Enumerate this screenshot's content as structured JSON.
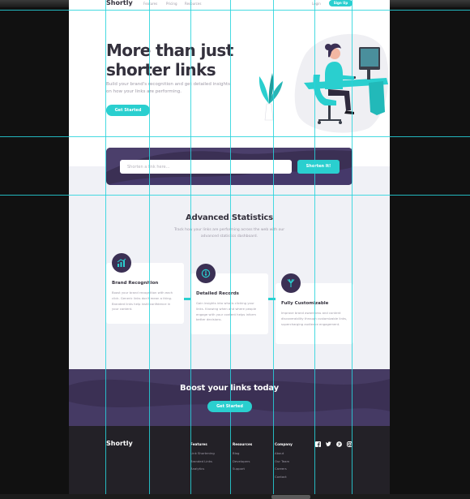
{
  "nav": {
    "logo": "Shortly",
    "links": [
      "Features",
      "Pricing",
      "Resources"
    ],
    "login": "Login",
    "signup": "Sign Up"
  },
  "hero": {
    "title": "More than just shorter links",
    "subtitle": "Build your brand's recognition and get detailed insights on how your links are performing.",
    "cta": "Get Started"
  },
  "shorten": {
    "placeholder": "Shorten a link here...",
    "button": "Shorten It!"
  },
  "statistics": {
    "title": "Advanced Statistics",
    "subtitle": "Track how your links are performing across the web with our advanced statistics dashboard.",
    "cards": [
      {
        "icon": "bar-chart-icon",
        "title": "Brand Recognition",
        "text": "Boost your brand recognition with each click. Generic links don't mean a thing. Branded links help instil confidence in your content."
      },
      {
        "icon": "gauge-icon",
        "title": "Detailed Records",
        "text": "Gain insights into who is clicking your links. Knowing when and where people engage with your content helps inform better decisions."
      },
      {
        "icon": "brush-icon",
        "title": "Fully Customizable",
        "text": "Improve brand awareness and content discoverability through customizable links, supercharging audience engagement."
      }
    ]
  },
  "boost": {
    "title": "Boost your links today",
    "cta": "Get Started"
  },
  "footer": {
    "logo": "Shortly",
    "columns": [
      {
        "title": "Features",
        "links": [
          "Link Shortening",
          "Branded Links",
          "Analytics"
        ]
      },
      {
        "title": "Resources",
        "links": [
          "Blog",
          "Developers",
          "Support"
        ]
      },
      {
        "title": "Company",
        "links": [
          "About",
          "Our Team",
          "Careers",
          "Contact"
        ]
      }
    ],
    "social": [
      "facebook-icon",
      "twitter-icon",
      "pinterest-icon",
      "instagram-icon"
    ]
  },
  "colors": {
    "cyan": "#2acfcf",
    "dark_violet": "#3b3054",
    "very_dark_blue": "#34313d",
    "gray": "#9e9aa7",
    "light_bg": "#f0f1f6",
    "footer_bg": "#232127",
    "guide": "#27d4dc"
  }
}
